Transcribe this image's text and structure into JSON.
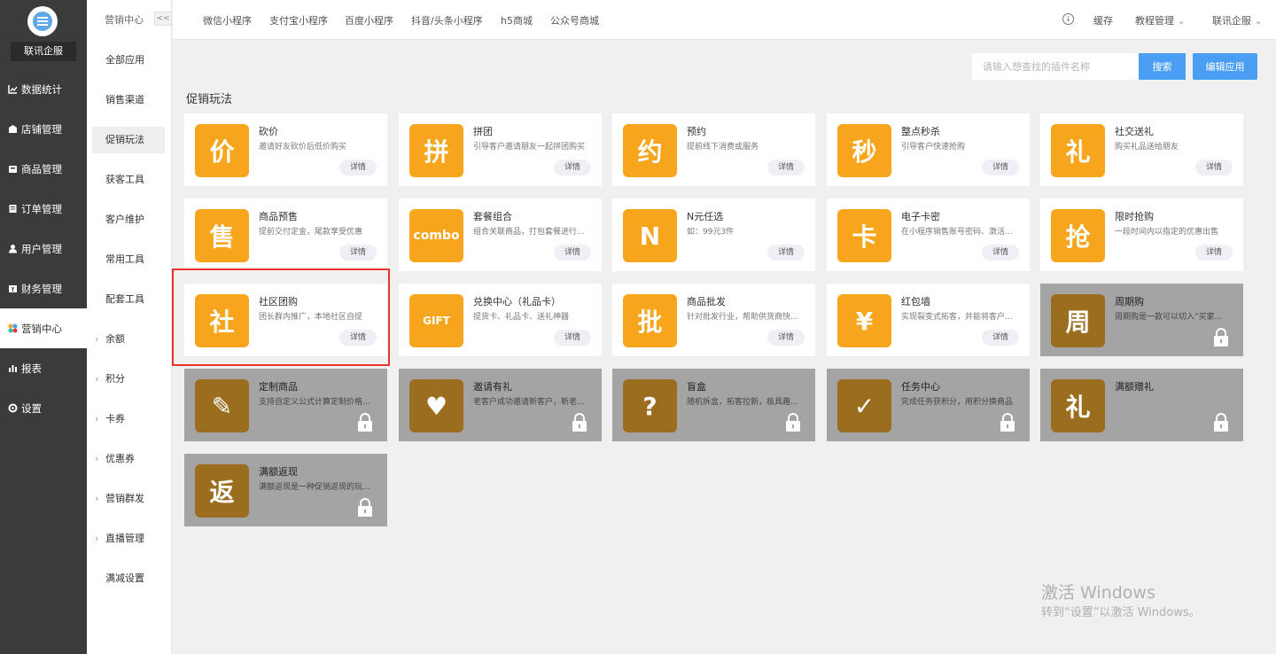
{
  "sidebar": {
    "company": "联讯企服",
    "items": [
      {
        "label": "数据统计",
        "icon": "chart-icon"
      },
      {
        "label": "店铺管理",
        "icon": "store-icon"
      },
      {
        "label": "商品管理",
        "icon": "goods-icon"
      },
      {
        "label": "订单管理",
        "icon": "order-icon"
      },
      {
        "label": "用户管理",
        "icon": "user-icon"
      },
      {
        "label": "财务管理",
        "icon": "finance-icon"
      },
      {
        "label": "营销中心",
        "icon": "marketing-icon"
      },
      {
        "label": "报表",
        "icon": "report-icon"
      },
      {
        "label": "设置",
        "icon": "settings-icon"
      }
    ]
  },
  "subnav": {
    "title": "营销中心",
    "collapse": "<<",
    "items": [
      {
        "label": "全部应用"
      },
      {
        "label": "销售渠道"
      },
      {
        "label": "促销玩法"
      },
      {
        "label": "获客工具"
      },
      {
        "label": "客户维护"
      },
      {
        "label": "常用工具"
      },
      {
        "label": "配套工具"
      },
      {
        "label": "余额"
      },
      {
        "label": "积分"
      },
      {
        "label": "卡券"
      },
      {
        "label": "优惠券"
      },
      {
        "label": "营销群发"
      },
      {
        "label": "直播管理"
      },
      {
        "label": "满减设置"
      }
    ]
  },
  "topbar": {
    "tabs": [
      "微信小程序",
      "支付宝小程序",
      "百度小程序",
      "抖音/头条小程序",
      "h5商城",
      "公众号商城"
    ],
    "cache": "缓存",
    "tutorial": "教程管理",
    "account": "联讯企服"
  },
  "search": {
    "placeholder": "请输入想查找的插件名称",
    "button": "搜索",
    "edit": "编辑应用"
  },
  "section_title": "促销玩法",
  "detail_label": "详情",
  "cards": [
    {
      "name": "砍价",
      "desc": "邀请好友砍价后低价购买",
      "glyph": "价",
      "locked": false
    },
    {
      "name": "拼团",
      "desc": "引导客户邀请朋友一起拼团购买",
      "glyph": "拼",
      "locked": false
    },
    {
      "name": "预约",
      "desc": "提前线下消费或服务",
      "glyph": "约",
      "locked": false
    },
    {
      "name": "整点秒杀",
      "desc": "引导客户快速抢购",
      "glyph": "秒",
      "locked": false
    },
    {
      "name": "社交送礼",
      "desc": "购买礼品送给朋友",
      "glyph": "礼",
      "locked": false
    },
    {
      "name": "商品预售",
      "desc": "提前交付定金，尾款享受优惠",
      "glyph": "售",
      "locked": false
    },
    {
      "name": "套餐组合",
      "desc": "组合关联商品，打包套餐进行...",
      "glyph": "combo",
      "locked": false
    },
    {
      "name": "N元任选",
      "desc": "如：99元3件",
      "glyph": "N",
      "locked": false
    },
    {
      "name": "电子卡密",
      "desc": "在小程序销售账号密码、激活...",
      "glyph": "卡",
      "locked": false
    },
    {
      "name": "限时抢购",
      "desc": "一段时间内以指定的优惠出售",
      "glyph": "抢",
      "locked": false
    },
    {
      "name": "社区团购",
      "desc": "团长群内推广，本地社区自提",
      "glyph": "社",
      "locked": false
    },
    {
      "name": "兑换中心（礼品卡）",
      "desc": "提货卡、礼品卡、送礼神器",
      "glyph": "GIFT",
      "locked": false
    },
    {
      "name": "商品批发",
      "desc": "针对批发行业，帮助供货商快...",
      "glyph": "批",
      "locked": false
    },
    {
      "name": "红包墙",
      "desc": "实现裂变式拓客，并能将客户...",
      "glyph": "¥",
      "locked": false
    },
    {
      "name": "周期购",
      "desc": "周期购是一款可以切入“买家...",
      "glyph": "周",
      "locked": true
    },
    {
      "name": "定制商品",
      "desc": "支持自定义公式计算定制价格...",
      "glyph": "✎",
      "locked": true
    },
    {
      "name": "邀请有礼",
      "desc": "老客户成功邀请新客户，新老...",
      "glyph": "♥",
      "locked": true
    },
    {
      "name": "盲盒",
      "desc": "随机拆盒，拓客拉新，极具趣...",
      "glyph": "?",
      "locked": true
    },
    {
      "name": "任务中心",
      "desc": "完成任务获积分，用积分换商品",
      "glyph": "✓",
      "locked": true
    },
    {
      "name": "满额赠礼",
      "desc": "",
      "glyph": "礼",
      "locked": true
    },
    {
      "name": "满额返现",
      "desc": "满额返现是一种促销返现的玩...",
      "glyph": "返",
      "locked": true
    }
  ],
  "watermark": {
    "line1": "激活 Windows",
    "line2": "转到“设置”以激活 Windows。"
  },
  "colors": {
    "accent": "#4a9ff5",
    "icon_orange": "#f7a51d",
    "highlight_red": "#e8332f"
  }
}
